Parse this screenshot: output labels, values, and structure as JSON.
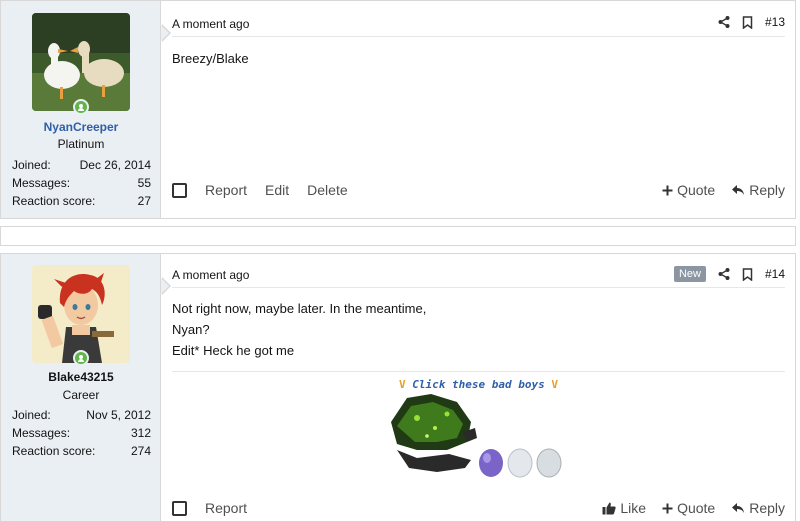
{
  "posts": [
    {
      "user": {
        "name": "NyanCreeper",
        "title": "Platinum",
        "name_color": "#2f5fa8",
        "stats": [
          {
            "label": "Joined:",
            "value": "Dec 26, 2014"
          },
          {
            "label": "Messages:",
            "value": "55"
          },
          {
            "label": "Reaction score:",
            "value": "27"
          }
        ]
      },
      "time": "A moment ago",
      "number": "#13",
      "body": [
        "Breezy/Blake"
      ],
      "actions_left": [
        "Report",
        "Edit",
        "Delete"
      ],
      "actions_right": [
        {
          "label": "Quote",
          "icon": "plus-icon"
        },
        {
          "label": "Reply",
          "icon": "reply-icon"
        }
      ]
    },
    {
      "user": {
        "name": "Blake43215",
        "title": "Career",
        "name_color": "#141414",
        "stats": [
          {
            "label": "Joined:",
            "value": "Nov 5, 2012"
          },
          {
            "label": "Messages:",
            "value": "312"
          },
          {
            "label": "Reaction score:",
            "value": "274"
          }
        ]
      },
      "time": "A moment ago",
      "badge": "New",
      "number": "#14",
      "body": [
        "Not right now, maybe later. In the meantime,",
        "Nyan?",
        "Edit* Heck he got me"
      ],
      "signature": {
        "prefix": "V",
        "text": "Click these bad boys",
        "suffix": "V"
      },
      "actions_left": [
        "Report"
      ],
      "actions_right": [
        {
          "label": "Like",
          "icon": "thumbs-up-icon"
        },
        {
          "label": "Quote",
          "icon": "plus-icon"
        },
        {
          "label": "Reply",
          "icon": "reply-icon"
        }
      ]
    }
  ]
}
